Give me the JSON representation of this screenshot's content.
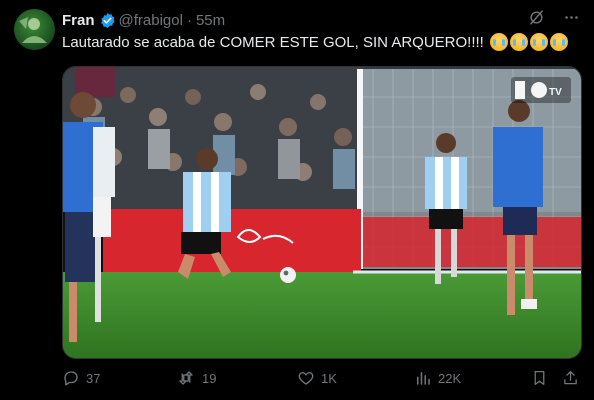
{
  "author": {
    "name": "Fran",
    "handle": "@frabigol",
    "separator": "·",
    "time": "55m"
  },
  "tweet": {
    "text": "Lautarado se acaba de COMER ESTE GOL, SIN ARQUERO!!!!",
    "emoji_count": 4
  },
  "media": {
    "broadcaster_label": "TV"
  },
  "actions": {
    "replies": "37",
    "retweets": "19",
    "likes": "1K",
    "views": "22K"
  },
  "colors": {
    "accent": "#1d9bf0",
    "muted": "#71767b",
    "text": "#e7e9ea",
    "argentina_kit": "#9fd0f2",
    "opponent_kit": "#2f6fd1"
  }
}
